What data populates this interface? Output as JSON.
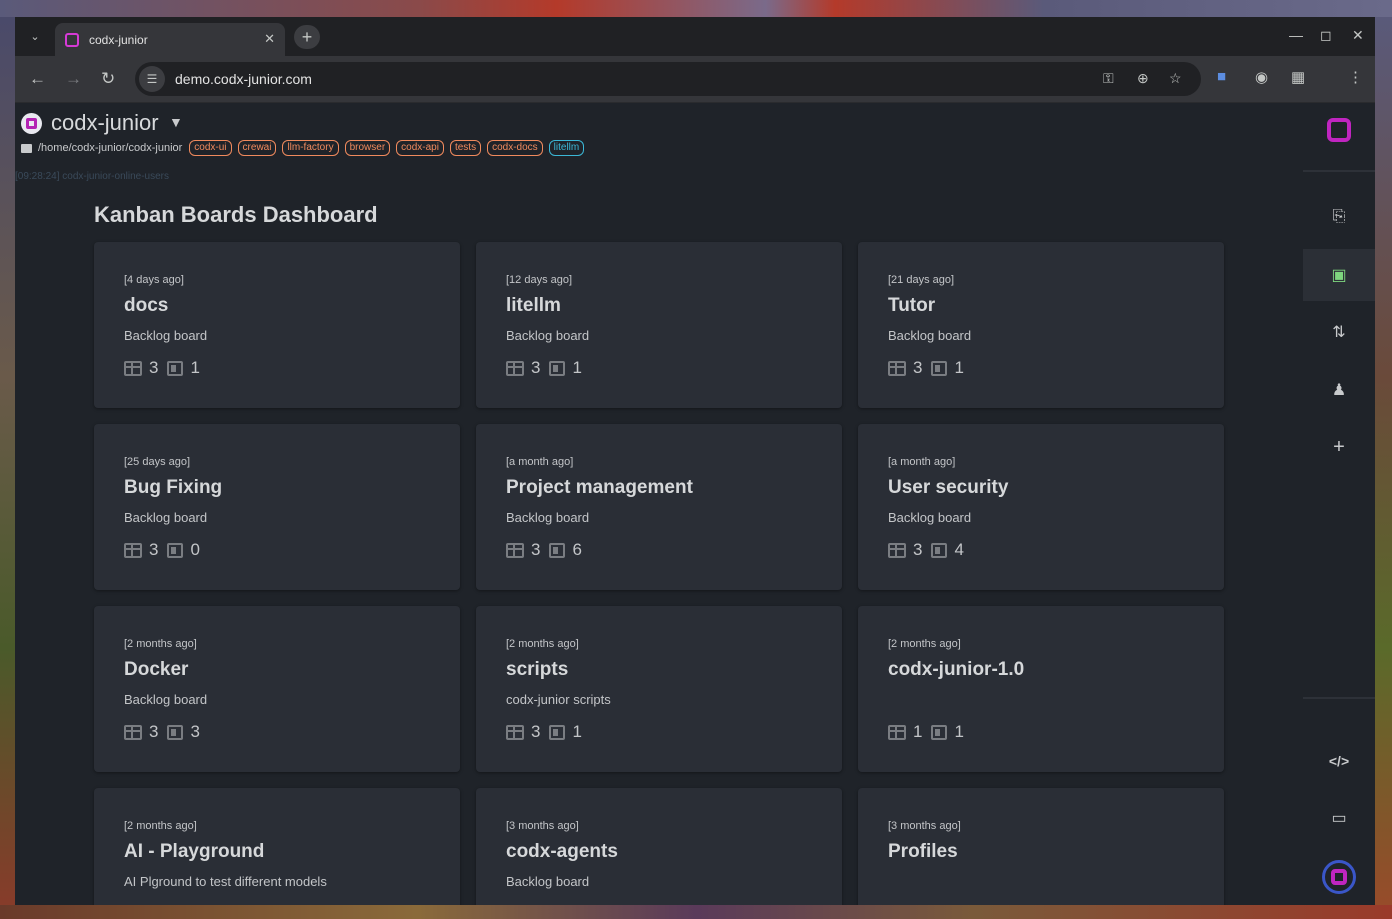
{
  "browser": {
    "tab_title": "codx-junior",
    "url": "demo.codx-junior.com"
  },
  "project": {
    "name": "codx-junior",
    "path": "/home/codx-junior/codx-junior",
    "tags": [
      "codx-ui",
      "crewai",
      "llm-factory",
      "browser",
      "codx-api",
      "tests",
      "codx-docs"
    ],
    "info_tag": "litellm",
    "log_line": "[09:28:24] codx-junior-online-users"
  },
  "dashboard": {
    "title": "Kanban Boards Dashboard",
    "boards": [
      {
        "date": "[4 days ago]",
        "title": "docs",
        "desc": "Backlog board",
        "columns": "3",
        "tasks": "1"
      },
      {
        "date": "[12 days ago]",
        "title": "litellm",
        "desc": "Backlog board",
        "columns": "3",
        "tasks": "1"
      },
      {
        "date": "[21 days ago]",
        "title": "Tutor",
        "desc": "Backlog board",
        "columns": "3",
        "tasks": "1"
      },
      {
        "date": "[25 days ago]",
        "title": "Bug Fixing",
        "desc": "Backlog board",
        "columns": "3",
        "tasks": "0"
      },
      {
        "date": "[a month ago]",
        "title": "Project management",
        "desc": "Backlog board",
        "columns": "3",
        "tasks": "6"
      },
      {
        "date": "[a month ago]",
        "title": "User security",
        "desc": "Backlog board",
        "columns": "3",
        "tasks": "4"
      },
      {
        "date": "[2 months ago]",
        "title": "Docker",
        "desc": "Backlog board",
        "columns": "3",
        "tasks": "3"
      },
      {
        "date": "[2 months ago]",
        "title": "scripts",
        "desc": "codx-junior scripts",
        "columns": "3",
        "tasks": "1"
      },
      {
        "date": "[2 months ago]",
        "title": "codx-junior-1.0",
        "desc": "",
        "columns": "1",
        "tasks": "1"
      },
      {
        "date": "[2 months ago]",
        "title": "AI - Playground",
        "desc": "AI Plground to test different models",
        "columns": "",
        "tasks": ""
      },
      {
        "date": "[3 months ago]",
        "title": "codx-agents",
        "desc": "Backlog board",
        "columns": "",
        "tasks": ""
      },
      {
        "date": "[3 months ago]",
        "title": "Profiles",
        "desc": "",
        "columns": "",
        "tasks": ""
      }
    ]
  },
  "sidebar": {
    "items": [
      {
        "name": "wiki-book",
        "icon": "book-icon"
      },
      {
        "name": "kanban",
        "icon": "kanban-icon",
        "active": true
      },
      {
        "name": "git",
        "icon": "git-compare-icon"
      },
      {
        "name": "users",
        "icon": "users-icon"
      },
      {
        "name": "add",
        "icon": "plus-icon"
      },
      {
        "name": "code",
        "icon": "code-icon"
      },
      {
        "name": "monitor",
        "icon": "monitor-icon"
      }
    ]
  },
  "colors": {
    "accent": "#c025c0",
    "tag": "#f08a5d",
    "info_tag": "#3bb7d6",
    "active_nav": "#7ed67e"
  }
}
